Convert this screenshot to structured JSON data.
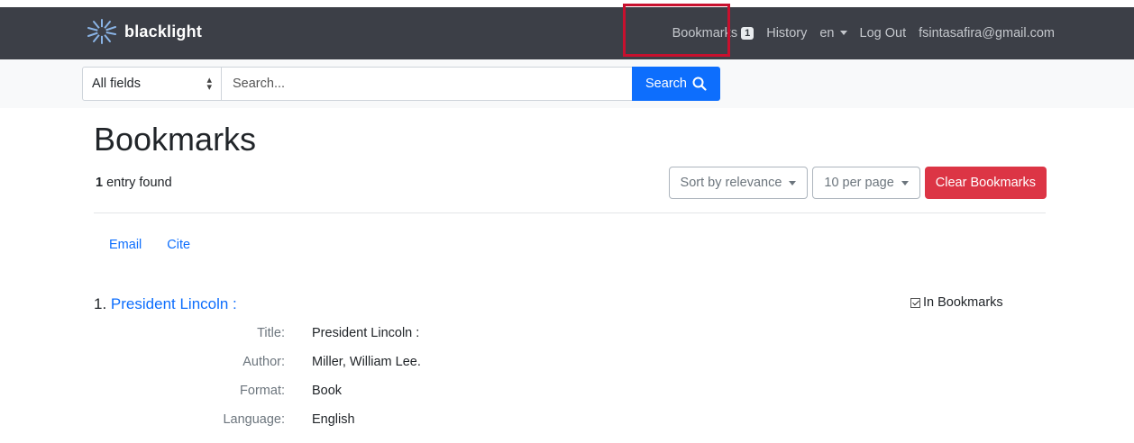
{
  "navbar": {
    "brand": "blacklight",
    "bookmarks_label": "Bookmarks",
    "bookmarks_count": "1",
    "history_label": "History",
    "language_label": "en",
    "logout_label": "Log Out",
    "user_email": "fsintasafira@gmail.com"
  },
  "search": {
    "field_selected": "All fields",
    "placeholder": "Search...",
    "button_label": "Search"
  },
  "page": {
    "title": "Bookmarks",
    "entry_count": "1",
    "entry_suffix": " entry found"
  },
  "toolbar": {
    "sort_label": "Sort by relevance",
    "per_page_label": "10 per page",
    "clear_label": "Clear Bookmarks"
  },
  "tools": {
    "email_label": "Email",
    "cite_label": "Cite"
  },
  "document": {
    "counter": "1.",
    "title_link": "President Lincoln :",
    "bookmark_label": "In Bookmarks",
    "fields": [
      {
        "label": "Title:",
        "value": "President Lincoln :"
      },
      {
        "label": "Author:",
        "value": "Miller, William Lee."
      },
      {
        "label": "Format:",
        "value": "Book"
      },
      {
        "label": "Language:",
        "value": "English"
      }
    ]
  },
  "colors": {
    "navbar_bg": "#3c3f47",
    "primary": "#0d6efd",
    "danger": "#dc3545",
    "highlight": "#c8102e"
  }
}
